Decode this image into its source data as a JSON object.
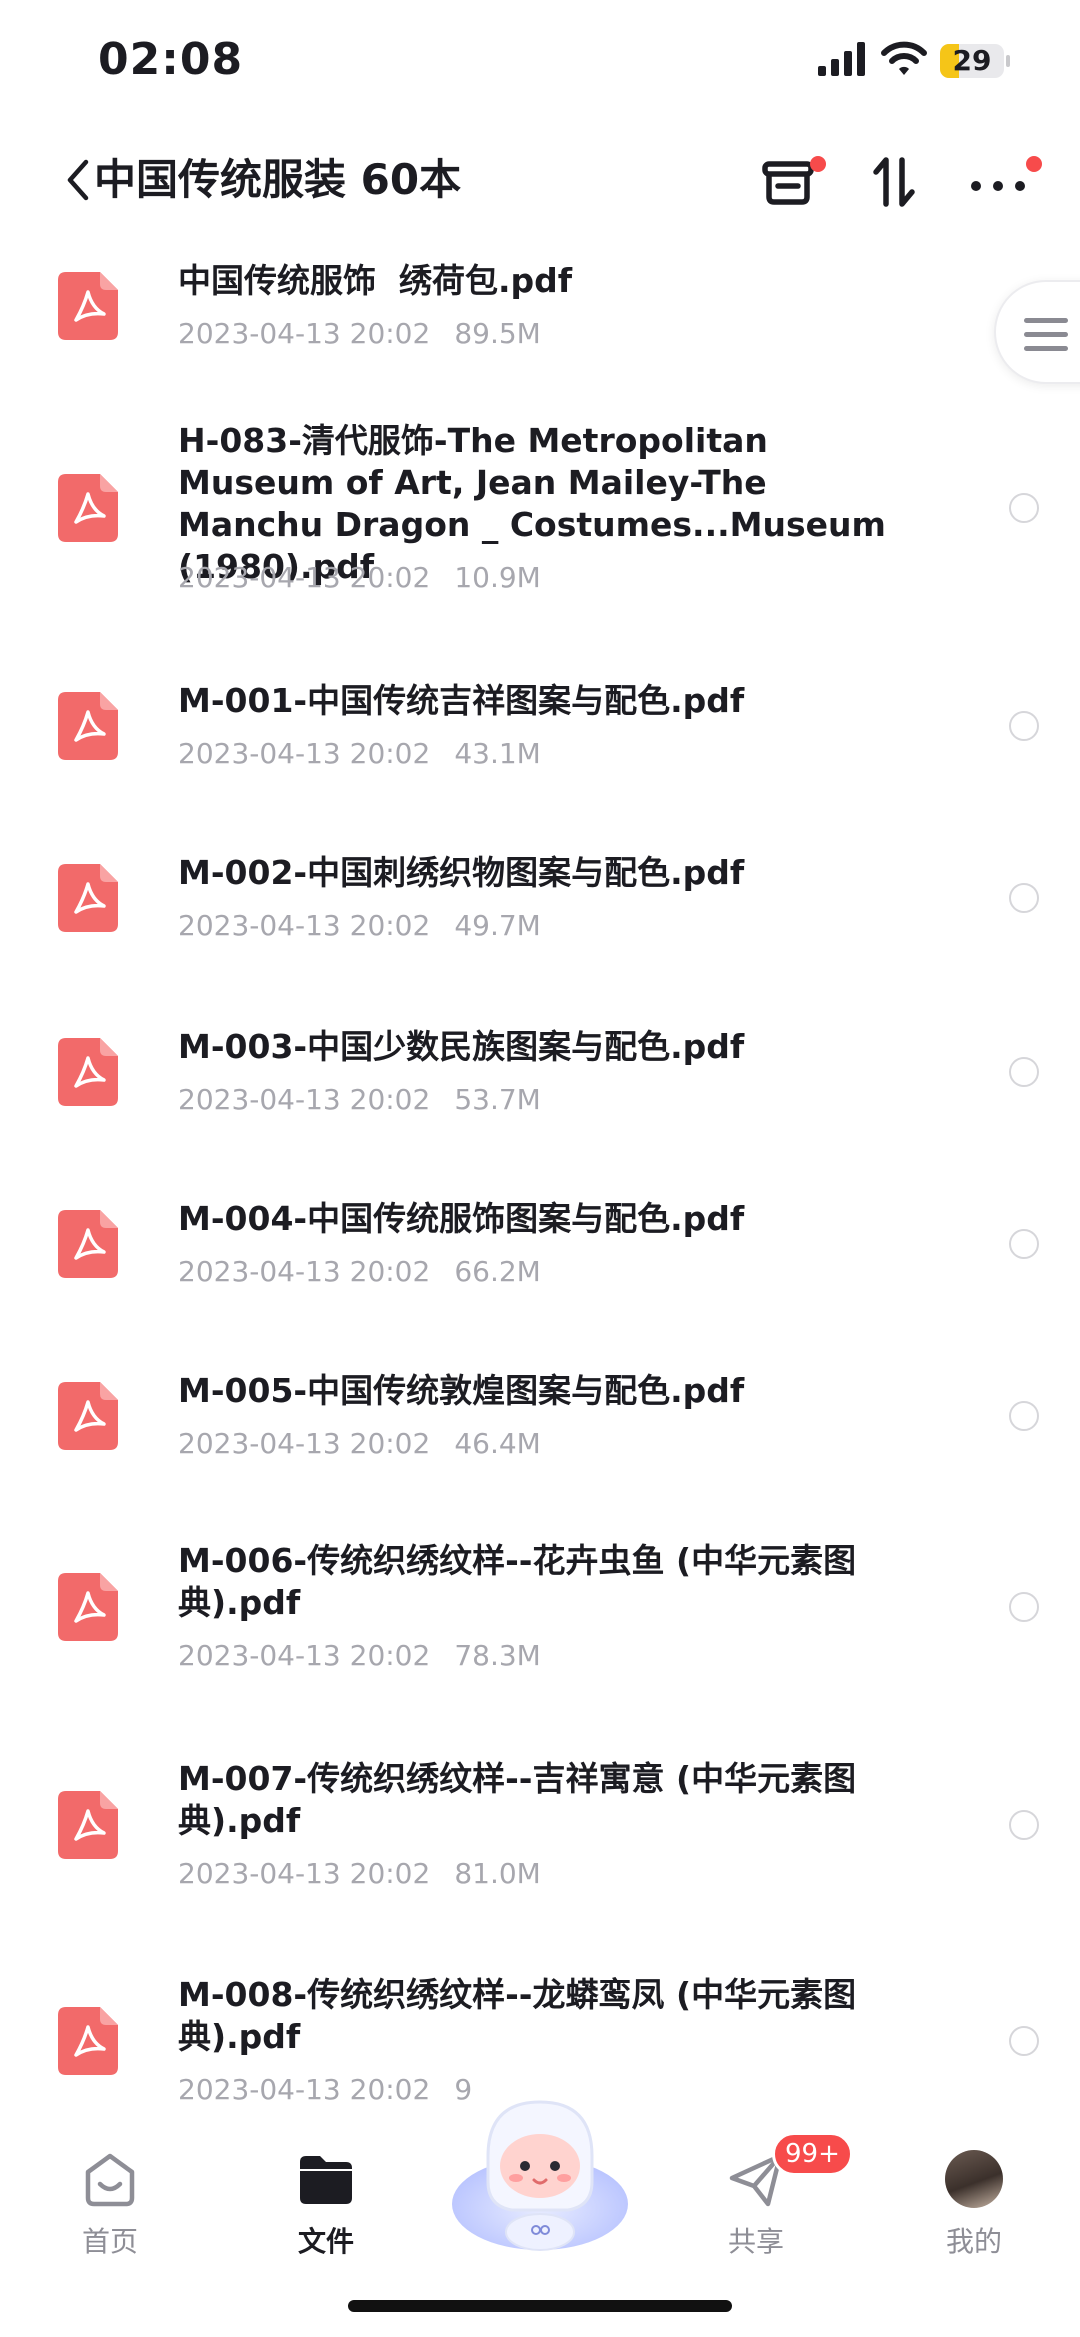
{
  "status_bar": {
    "time": "02:08",
    "battery": "29",
    "battery_level_percent": 29
  },
  "header": {
    "title": "中国传统服装 60本"
  },
  "colors": {
    "accent_red": "#f74b4b",
    "pdf_red": "#f26a6a",
    "meta_gray": "#a7a7ae"
  },
  "icons": {
    "back": "chevron-left-icon",
    "basket": "basket-icon",
    "sort": "sort-arrows-icon",
    "more": "more-dots-icon",
    "side_tab": "menu-lines-icon",
    "file": "pdf-icon"
  },
  "files": [
    {
      "name": "中国传统服饰  绣荷包.pdf",
      "date": "2023-04-13 20:02",
      "size": "89.5M"
    },
    {
      "name": "H-083-清代服饰-The Metropolitan Museum of Art, Jean Mailey-The Manchu Dragon _ Costumes...Museum (1980).pdf",
      "date": "2023-04-13 20:02",
      "size": "10.9M"
    },
    {
      "name": "M-001-中国传统吉祥图案与配色.pdf",
      "date": "2023-04-13 20:02",
      "size": "43.1M"
    },
    {
      "name": "M-002-中国刺绣织物图案与配色.pdf",
      "date": "2023-04-13 20:02",
      "size": "49.7M"
    },
    {
      "name": "M-003-中国少数民族图案与配色.pdf",
      "date": "2023-04-13 20:02",
      "size": "53.7M"
    },
    {
      "name": "M-004-中国传统服饰图案与配色.pdf",
      "date": "2023-04-13 20:02",
      "size": "66.2M"
    },
    {
      "name": "M-005-中国传统敦煌图案与配色.pdf",
      "date": "2023-04-13 20:02",
      "size": "46.4M"
    },
    {
      "name": "M-006-传统织绣纹样--花卉虫鱼 (中华元素图典).pdf",
      "date": "2023-04-13 20:02",
      "size": "78.3M"
    },
    {
      "name": "M-007-传统织绣纹样--吉祥寓意 (中华元素图典).pdf",
      "date": "2023-04-13 20:02",
      "size": "81.0M"
    },
    {
      "name": "M-008-传统织绣纹样--龙蟒鸾凤 (中华元素图典).pdf",
      "date": "2023-04-13 20:02",
      "size": "9"
    }
  ],
  "tabs": [
    {
      "label": "首页",
      "icon": "home-icon"
    },
    {
      "label": "文件",
      "icon": "folder-icon"
    },
    {
      "label": "共享",
      "icon": "paper-plane-icon",
      "badge": "99+"
    },
    {
      "label": "我的",
      "icon": "avatar-icon"
    }
  ],
  "mascot": {
    "icon": "mascot-icon"
  }
}
